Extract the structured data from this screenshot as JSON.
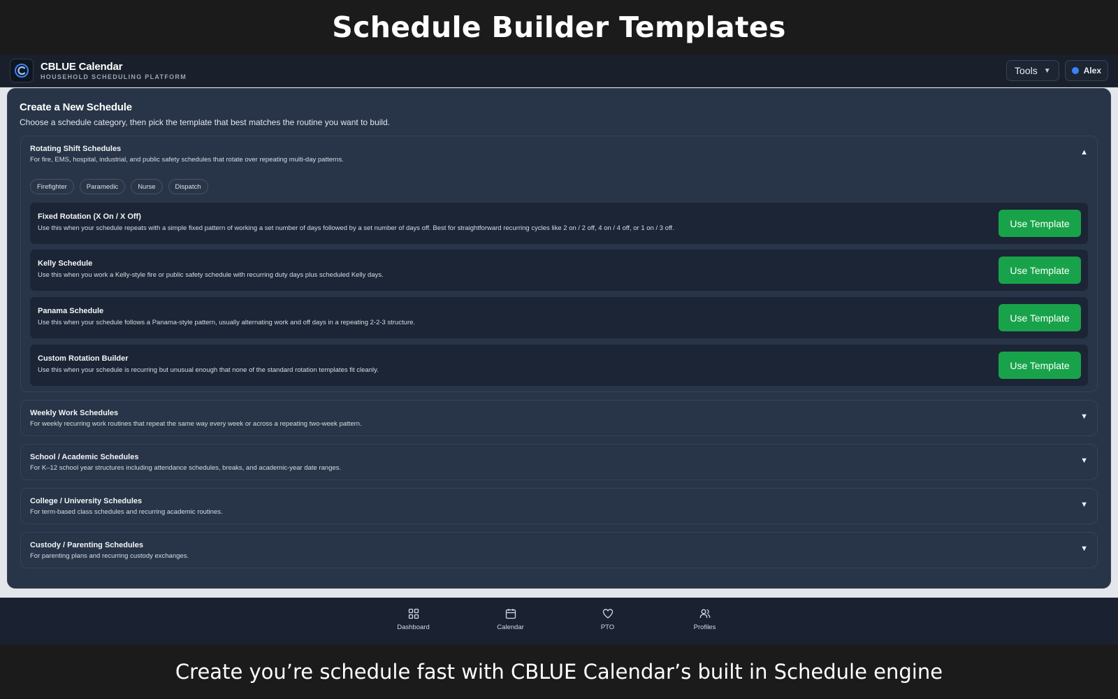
{
  "banner_top": "Schedule Builder Templates",
  "banner_bottom": "Create you’re schedule fast with CBLUE Calendar’s built in Schedule engine",
  "app": {
    "name": "CBLUE Calendar",
    "subtitle": "HOUSEHOLD SCHEDULING PLATFORM",
    "tools_label": "Tools",
    "user_name": "Alex",
    "user_dot_color": "#3b82f6"
  },
  "panel": {
    "title": "Create a New Schedule",
    "description": "Choose a schedule category, then pick the template that best matches the routine you want to build."
  },
  "categories": [
    {
      "title": "Rotating Shift Schedules",
      "description": "For fire, EMS, hospital, industrial, and public safety schedules that rotate over repeating multi-day patterns.",
      "expanded": true,
      "toggle": "▲",
      "chips": [
        "Firefighter",
        "Paramedic",
        "Nurse",
        "Dispatch"
      ],
      "templates": [
        {
          "name": "Fixed Rotation (X On / X Off)",
          "description": "Use this when your schedule repeats with a simple fixed pattern of working a set number of days followed by a set number of days off. Best for straightforward recurring cycles like 2 on / 2 off, 4 on / 4 off, or 1 on / 3 off.",
          "button": "Use Template"
        },
        {
          "name": "Kelly Schedule",
          "description": "Use this when you work a Kelly-style fire or public safety schedule with recurring duty days plus scheduled Kelly days.",
          "button": "Use Template"
        },
        {
          "name": "Panama Schedule",
          "description": "Use this when your schedule follows a Panama-style pattern, usually alternating work and off days in a repeating 2-2-3 structure.",
          "button": "Use Template"
        },
        {
          "name": "Custom Rotation Builder",
          "description": "Use this when your schedule is recurring but unusual enough that none of the standard rotation templates fit cleanly.",
          "button": "Use Template"
        }
      ]
    },
    {
      "title": "Weekly Work Schedules",
      "description": "For weekly recurring work routines that repeat the same way every week or across a repeating two-week pattern.",
      "expanded": false,
      "toggle": "▼"
    },
    {
      "title": "School / Academic Schedules",
      "description": "For K–12 school year structures including attendance schedules, breaks, and academic-year date ranges.",
      "expanded": false,
      "toggle": "▼"
    },
    {
      "title": "College / University Schedules",
      "description": "For term-based class schedules and recurring academic routines.",
      "expanded": false,
      "toggle": "▼"
    },
    {
      "title": "Custody / Parenting Schedules",
      "description": "For parenting plans and recurring custody exchanges.",
      "expanded": false,
      "toggle": "▼"
    }
  ],
  "nav": [
    {
      "label": "Dashboard",
      "icon": "dashboard-icon"
    },
    {
      "label": "Calendar",
      "icon": "calendar-icon"
    },
    {
      "label": "PTO",
      "icon": "heart-icon"
    },
    {
      "label": "Profiles",
      "icon": "users-icon"
    }
  ],
  "colors": {
    "accent_green": "#18a34a",
    "panel_bg": "#283447",
    "card_bg": "#1c2535"
  }
}
